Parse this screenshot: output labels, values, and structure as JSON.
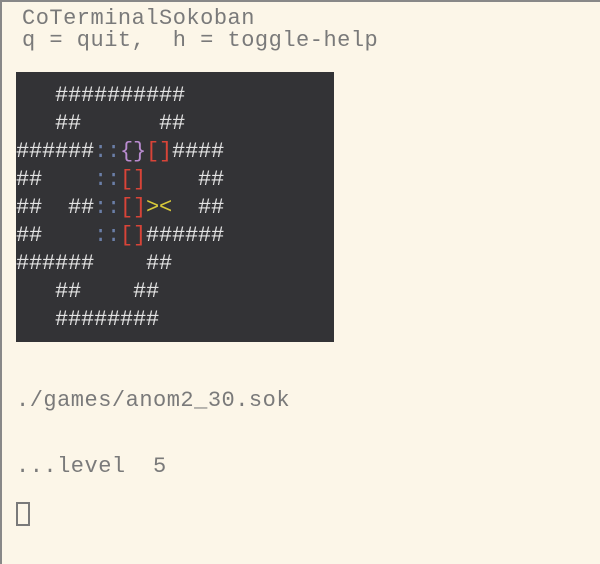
{
  "header": {
    "title": "CoTerminalSokoban",
    "hint": "q = quit,  h = toggle-help"
  },
  "footer": {
    "path": "./games/anom2_30.sok",
    "level": "...level  5"
  },
  "glyphs": {
    "wall": "#",
    "empty": " ",
    "target": ":",
    "box_l": "[",
    "box_r": "]",
    "boxon_l": "{",
    "boxon_r": "}",
    "player_l": ">",
    "player_r": "<"
  },
  "colors": {
    "bg": "#fcf6e8",
    "text": "#7a7a7a",
    "game_bg": "#333336",
    "wall": "#e4e4e4",
    "target": "#6b7fa8",
    "box": "#d84438",
    "box_on_target": "#b98bd0",
    "player": "#d8c93a"
  },
  "board": {
    "width_cells": 24,
    "rows": [
      "   ##########   ",
      "   ##      ##   ",
      "######::{}[]####",
      "##    ::[]    ##",
      "##  ##::[]><  ##",
      "##    ::[]######",
      "######    ##    ",
      "   ##    ##     ",
      "   ########     "
    ],
    "legend": {
      "#": "wall",
      " ": "empty-floor",
      ":": "target-cell",
      "{}": "box-on-target",
      "[]": "box",
      "><": "player"
    }
  }
}
